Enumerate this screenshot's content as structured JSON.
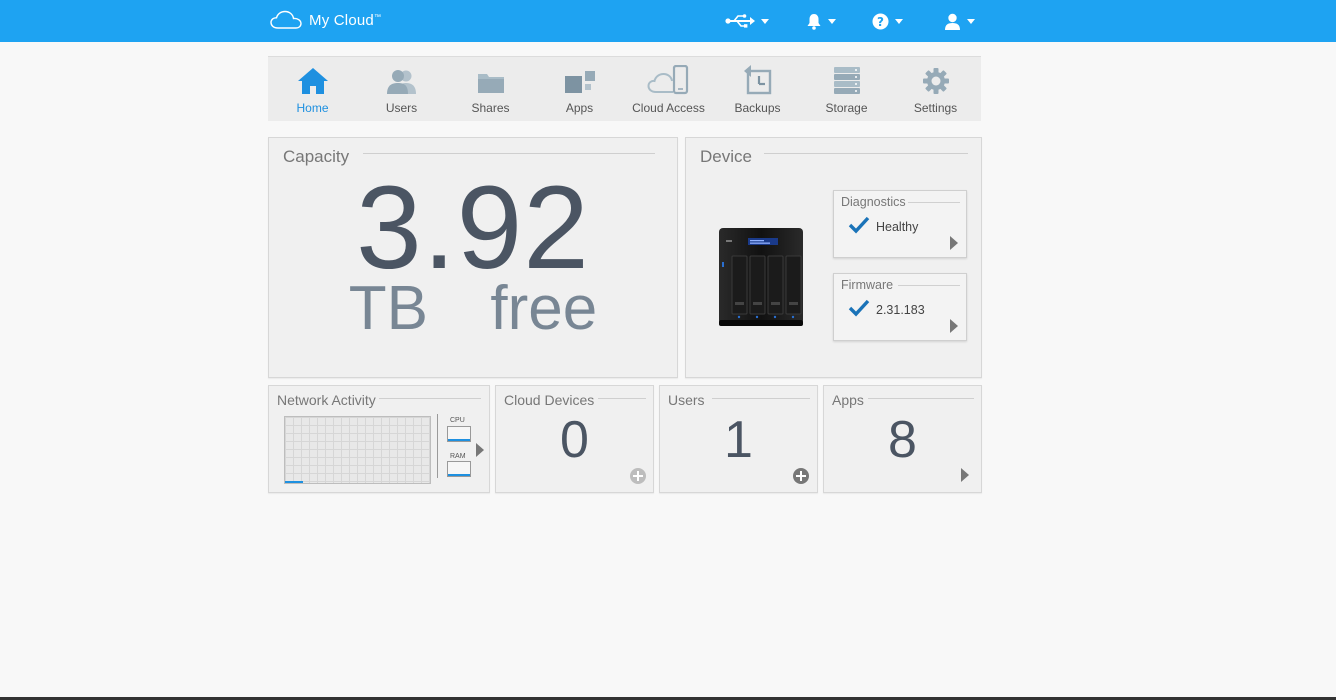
{
  "header": {
    "app_title": "My Cloud",
    "trademark": "™",
    "icons": [
      "cloud-logo-icon",
      "usb-icon",
      "bell-icon",
      "help-icon",
      "user-icon"
    ]
  },
  "nav": {
    "items": [
      {
        "label": "Home",
        "icon": "home-icon",
        "active": true
      },
      {
        "label": "Users",
        "icon": "users-icon"
      },
      {
        "label": "Shares",
        "icon": "folder-icon"
      },
      {
        "label": "Apps",
        "icon": "apps-icon"
      },
      {
        "label": "Cloud Access",
        "icon": "cloud-access-icon"
      },
      {
        "label": "Backups",
        "icon": "backup-icon"
      },
      {
        "label": "Storage",
        "icon": "storage-icon"
      },
      {
        "label": "Settings",
        "icon": "gear-icon"
      }
    ]
  },
  "capacity": {
    "title": "Capacity",
    "value": "3.92",
    "unit": "TB  free"
  },
  "device": {
    "title": "Device",
    "diagnostics": {
      "title": "Diagnostics",
      "value": "Healthy"
    },
    "firmware": {
      "title": "Firmware",
      "value": "2.31.183"
    }
  },
  "network": {
    "title": "Network Activity",
    "cpu_label": "CPU",
    "ram_label": "RAM"
  },
  "cloud_devices": {
    "title": "Cloud Devices",
    "value": "0"
  },
  "users": {
    "title": "Users",
    "value": "1"
  },
  "apps": {
    "title": "Apps",
    "value": "8"
  },
  "colors": {
    "header": "#1ea3f2",
    "accent": "#1e90e0",
    "check": "#1a73b8"
  }
}
